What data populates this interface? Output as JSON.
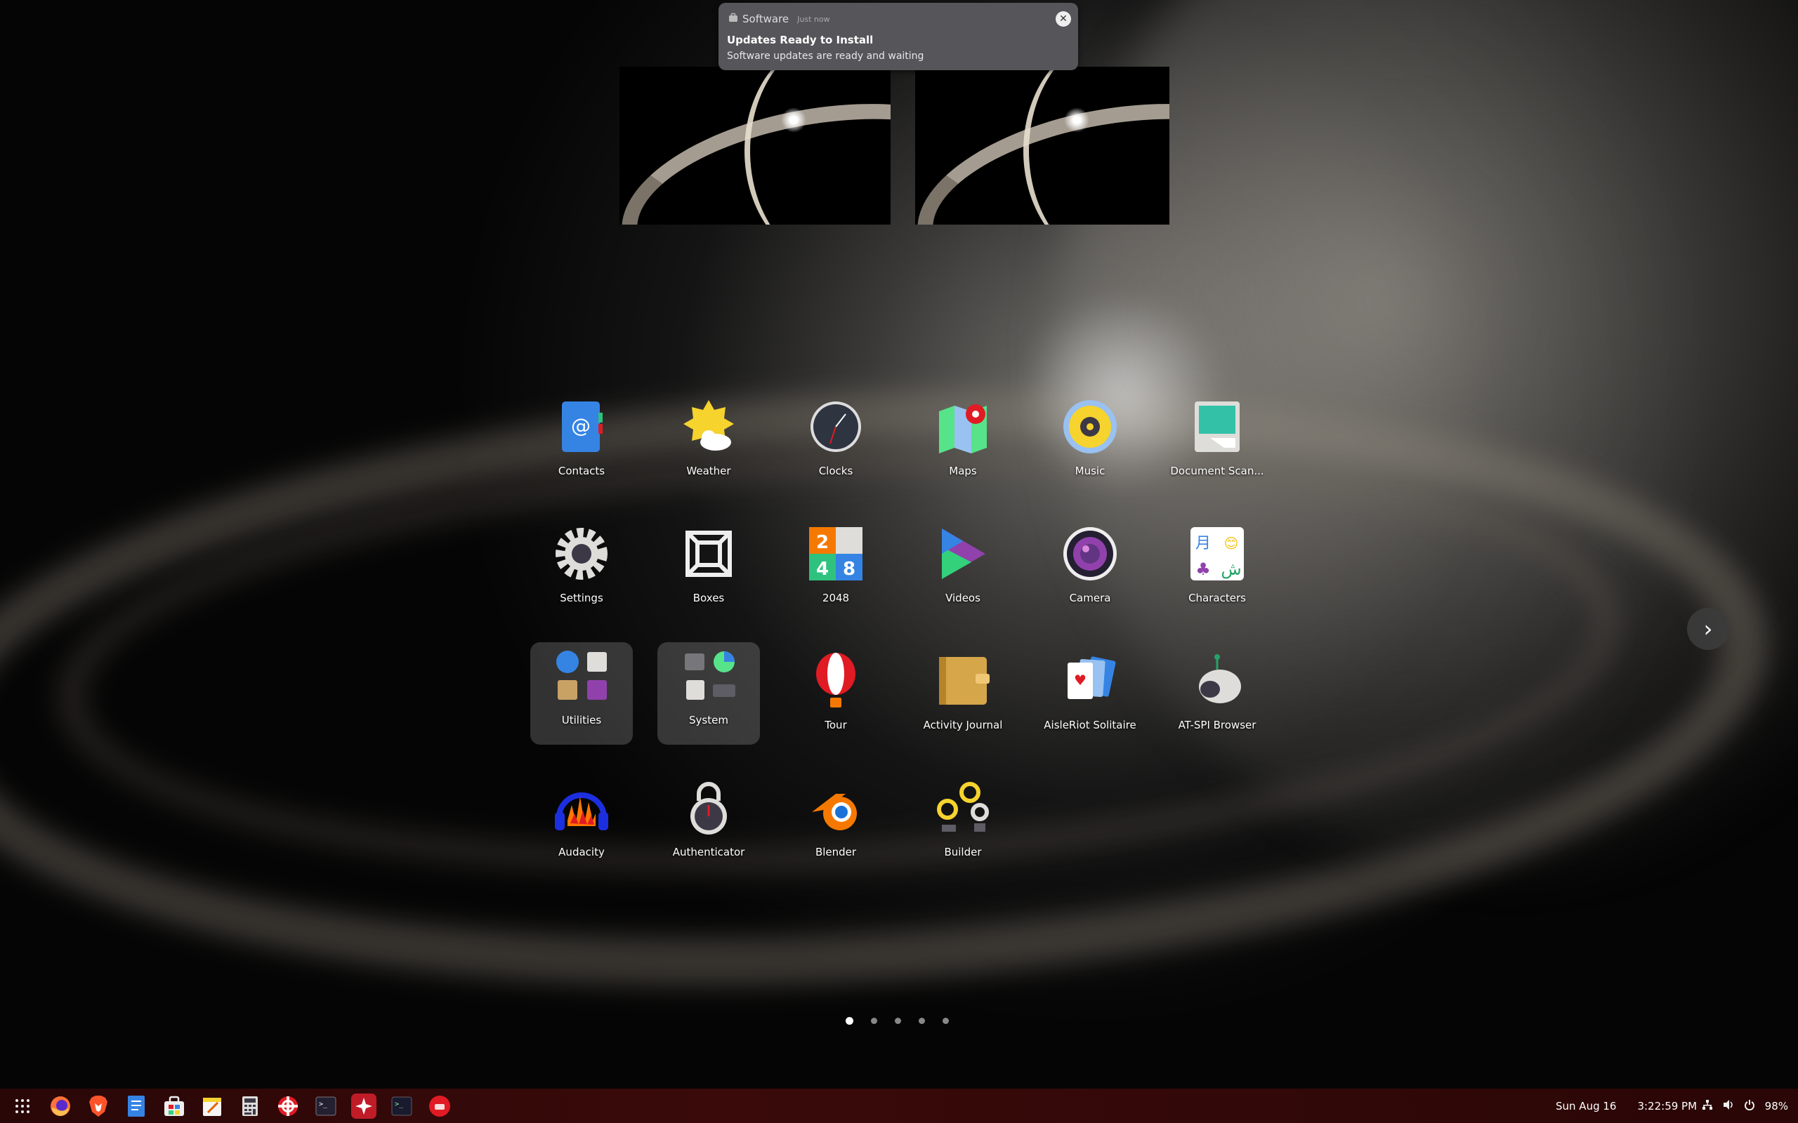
{
  "notification": {
    "app": "Software",
    "time": "Just now",
    "title": "Updates Ready to Install",
    "body": "Software updates are ready and waiting"
  },
  "apps": [
    {
      "label": "Contacts",
      "icon": "contacts-icon"
    },
    {
      "label": "Weather",
      "icon": "weather-icon"
    },
    {
      "label": "Clocks",
      "icon": "clocks-icon"
    },
    {
      "label": "Maps",
      "icon": "maps-icon"
    },
    {
      "label": "Music",
      "icon": "music-icon"
    },
    {
      "label": "Document Scan...",
      "icon": "document-scanner-icon"
    },
    {
      "label": "Settings",
      "icon": "settings-icon"
    },
    {
      "label": "Boxes",
      "icon": "boxes-icon"
    },
    {
      "label": "2048",
      "icon": "2048-icon"
    },
    {
      "label": "Videos",
      "icon": "videos-icon"
    },
    {
      "label": "Camera",
      "icon": "camera-icon"
    },
    {
      "label": "Characters",
      "icon": "characters-icon"
    },
    {
      "label": "Utilities",
      "icon": "utilities-folder-icon"
    },
    {
      "label": "System",
      "icon": "system-folder-icon"
    },
    {
      "label": "Tour",
      "icon": "tour-icon"
    },
    {
      "label": "Activity Journal",
      "icon": "activity-journal-icon"
    },
    {
      "label": "AisleRiot Solitaire",
      "icon": "solitaire-icon"
    },
    {
      "label": "AT-SPI Browser",
      "icon": "atspi-browser-icon"
    },
    {
      "label": "Audacity",
      "icon": "audacity-icon"
    },
    {
      "label": "Authenticator",
      "icon": "authenticator-icon"
    },
    {
      "label": "Blender",
      "icon": "blender-icon"
    },
    {
      "label": "Builder",
      "icon": "builder-icon"
    }
  ],
  "tile_2048": {
    "a": "2",
    "b": "4",
    "c": "8"
  },
  "characters_glyphs": {
    "a": "月",
    "b": "😊",
    "c": "♣",
    "d": "ش"
  },
  "pagination": {
    "pages": 5,
    "current": 1
  },
  "dock": [
    "app-grid-icon",
    "firefox-icon",
    "brave-icon",
    "text-editor-icon",
    "software-icon",
    "notes-icon",
    "calculator-icon",
    "help-icon",
    "terminal-icon",
    "red-app-icon",
    "console-icon",
    "red-circle-app-icon"
  ],
  "panel": {
    "date": "Sun Aug 16",
    "time": "3:22:59 PM",
    "battery": "98%"
  },
  "colors": {
    "panel": "#3a0a0a",
    "notification": "#55555a"
  }
}
